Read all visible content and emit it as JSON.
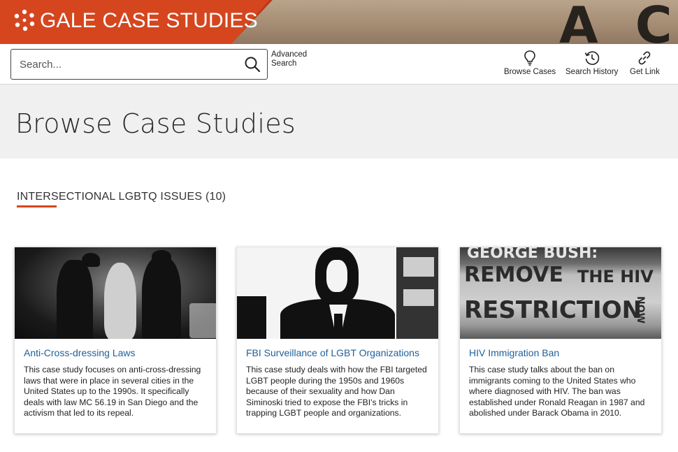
{
  "banner": {
    "brand_title": "GALE CASE STUDIES",
    "mural_text": "A CHANGE",
    "brand_color": "#d5461f"
  },
  "toolbar": {
    "search_placeholder": "Search...",
    "advanced_search_label": "Advanced Search",
    "tools": [
      {
        "label": "Browse Cases",
        "icon": "lightbulb-icon"
      },
      {
        "label": "Search History",
        "icon": "history-icon"
      },
      {
        "label": "Get Link",
        "icon": "link-icon"
      }
    ]
  },
  "page": {
    "title": "Browse Case Studies"
  },
  "section": {
    "heading": "INTERSECTIONAL LGBTQ ISSUES (10)"
  },
  "cards": [
    {
      "title": "Anti-Cross-dressing Laws",
      "description": "This case study focuses on anti-cross-dressing laws that were in place in several cities in the United States up to the 1990s. It specifically deals with law MC 56.19 in San Diego and the activism that led to its repeal."
    },
    {
      "title": "FBI Surveillance of LGBT Organizations",
      "description": "This case study deals with how the FBI targeted LGBT people during the 1950s and 1960s because of their sexuality and how Dan Siminoski tried to expose the FBI's tricks in trapping LGBT people and organizations."
    },
    {
      "title": "HIV Immigration Ban",
      "description": "This case study talks about the ban on immigrants coming to the United States who where diagnosed with HIV. The ban was established under Ronald Reagan in 1987 and abolished under Barack Obama in 2010.",
      "image_text": {
        "line1": "GEORGE BUSH:",
        "line2": "REMOVE",
        "line2b": "THE HIV",
        "line3": "RESTRICTION",
        "line3b": "NOW"
      }
    }
  ]
}
